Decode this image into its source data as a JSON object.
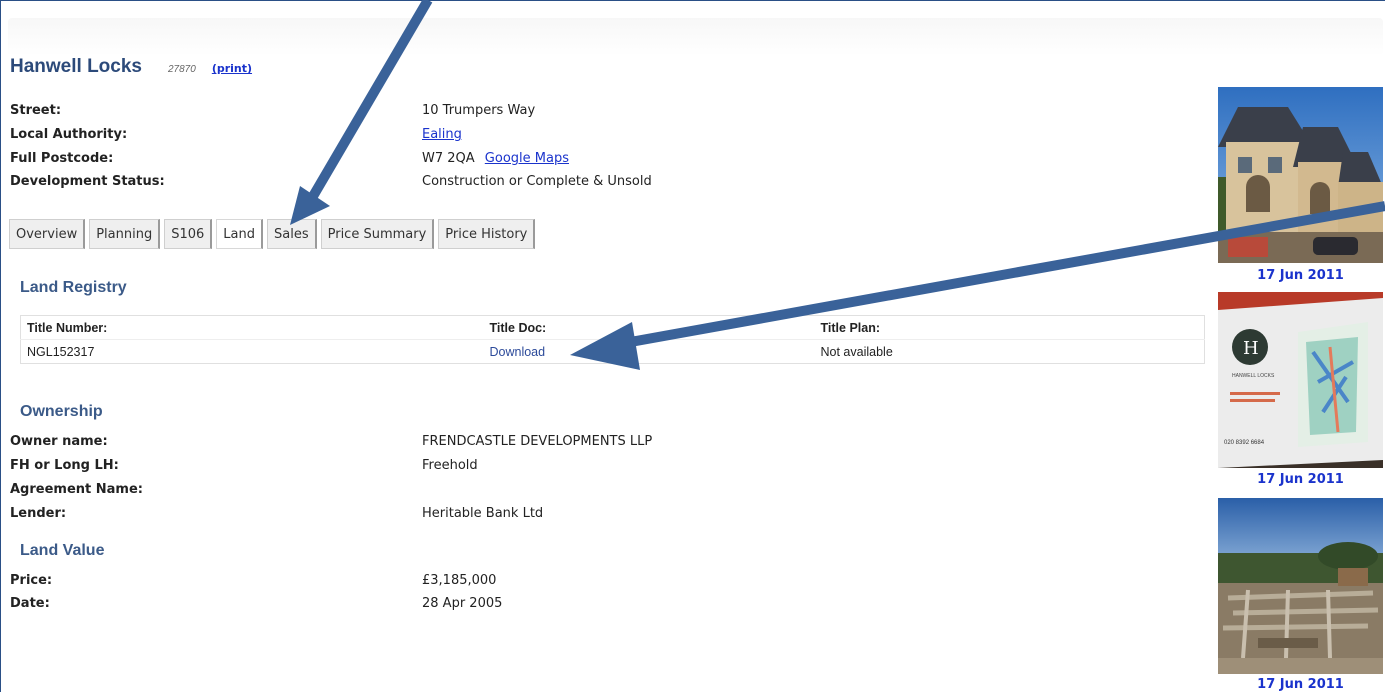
{
  "header": {
    "title": "Hanwell Locks",
    "id": "27870",
    "print_label": "(print)"
  },
  "details": {
    "street": {
      "label": "Street:",
      "value": "10 Trumpers Way"
    },
    "local_authority": {
      "label": "Local Authority:",
      "value": "Ealing"
    },
    "postcode": {
      "label": "Full Postcode:",
      "value": "W7 2QA",
      "maps_link": "Google Maps"
    },
    "status": {
      "label": "Development Status:",
      "value": "Construction or Complete & Unsold"
    }
  },
  "tabs": [
    "Overview",
    "Planning",
    "S106",
    "Land",
    "Sales",
    "Price Summary",
    "Price History"
  ],
  "active_tab": "Land",
  "land_registry": {
    "heading": "Land Registry",
    "headers": [
      "Title Number:",
      "Title Doc:",
      "Title Plan:"
    ],
    "row": {
      "title_number": "NGL152317",
      "title_doc": "Download",
      "title_plan": "Not available"
    }
  },
  "ownership": {
    "heading": "Ownership",
    "owner_name": {
      "label": "Owner name:",
      "value": "FRENDCASTLE DEVELOPMENTS LLP"
    },
    "tenure": {
      "label": "FH or Long LH:",
      "value": "Freehold"
    },
    "agreement_name": {
      "label": "Agreement Name:",
      "value": ""
    },
    "lender": {
      "label": "Lender:",
      "value": "Heritable Bank Ltd"
    }
  },
  "land_value": {
    "heading": "Land Value",
    "price": {
      "label": "Price:",
      "value": "£3,185,000"
    },
    "date": {
      "label": "Date:",
      "value": "28 Apr 2005"
    }
  },
  "photos": [
    {
      "caption": "17 Jun 2011",
      "subject": "terraced houses under construction"
    },
    {
      "caption": "17 Jun 2011",
      "subject": "site hoarding sign"
    },
    {
      "caption": "17 Jun 2011",
      "subject": "construction site foundations"
    }
  ],
  "sign_text": {
    "logo_letter": "H",
    "brand": "HANWELL LOCKS",
    "phone": "020 8392 6684"
  },
  "colors": {
    "heading": "#3b5a88",
    "link": "#1a33cc",
    "arrow": "#3a6299"
  }
}
